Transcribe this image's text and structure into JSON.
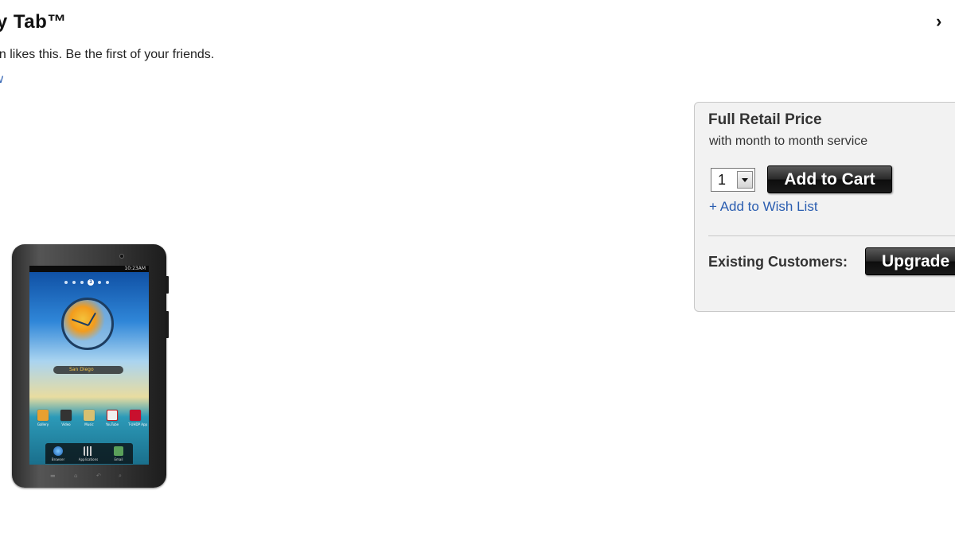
{
  "product": {
    "title": "xy Tab™",
    "next_arrow": "›",
    "like_text": "on likes this. Be the first of your friends.",
    "review_link": "iew"
  },
  "tablet_image": {
    "status_time": "10:23AM",
    "weather_city": "San Diego",
    "apps": [
      "Gallery",
      "Video",
      "Music",
      "YouTube",
      "T-UHDP App"
    ],
    "dock": [
      "Browser",
      "Applications",
      "Email"
    ],
    "colors": {
      "bezel": "#2c2c2c",
      "sky": "#2f86d8",
      "sea": "#2c9ab8"
    }
  },
  "purchase": {
    "price_label": "Full Retail Price",
    "service_note": "with month to month service",
    "quantity": "1",
    "add_to_cart": "Add to Cart",
    "wishlist": "+ Add to Wish List",
    "existing_customers": "Existing Customers:",
    "upgrade": "Upgrade",
    "colors": {
      "panel_bg": "#f2f2f2",
      "button_bg": "#1a1a1a",
      "link": "#2a5db0"
    }
  }
}
